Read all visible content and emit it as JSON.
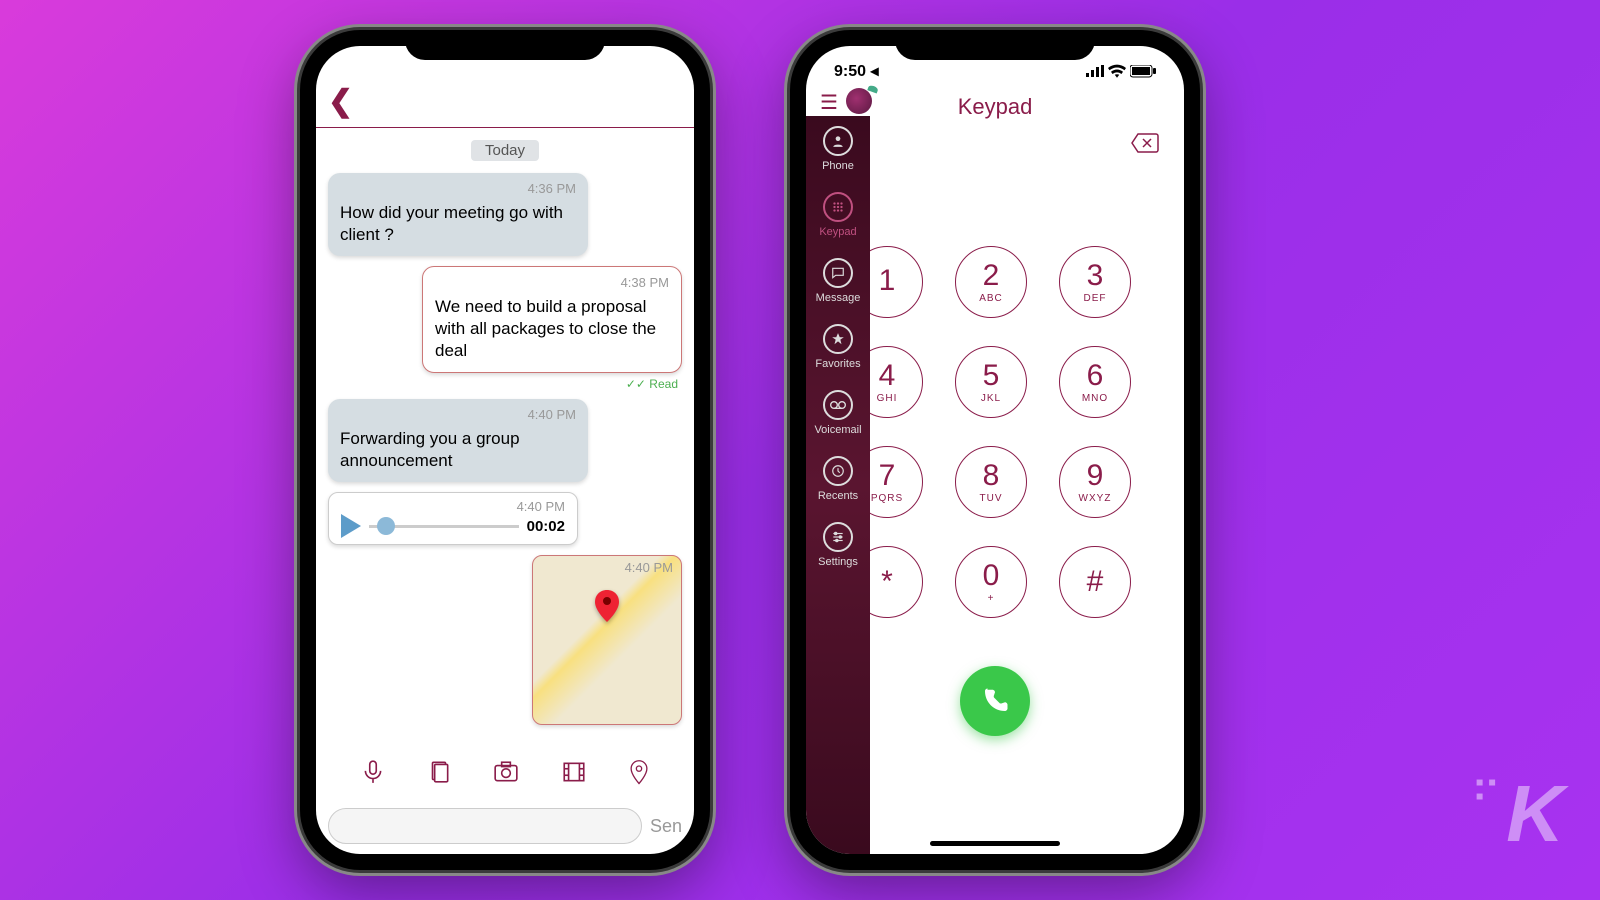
{
  "chat": {
    "day_label": "Today",
    "messages": [
      {
        "time": "4:36 PM",
        "text": "How did your meeting go with client ?"
      },
      {
        "time": "4:38 PM",
        "text": "We need to build a proposal with all packages to close the deal"
      },
      {
        "time": "4:40 PM",
        "text": "Forwarding you a group announcement"
      }
    ],
    "read_status": "✓✓ Read",
    "audio": {
      "time": "4:40 PM",
      "duration": "00:02"
    },
    "map": {
      "time": "4:40 PM"
    },
    "send_label": "Sen"
  },
  "keypad": {
    "status_time": "9:50 ◂",
    "header": "Keypad",
    "drawer": [
      {
        "label": "Phone"
      },
      {
        "label": "Keypad"
      },
      {
        "label": "Message"
      },
      {
        "label": "Favorites"
      },
      {
        "label": "Voicemail"
      },
      {
        "label": "Recents"
      },
      {
        "label": "Settings"
      }
    ],
    "keys": [
      {
        "num": "1",
        "letters": ""
      },
      {
        "num": "2",
        "letters": "ABC"
      },
      {
        "num": "3",
        "letters": "DEF"
      },
      {
        "num": "4",
        "letters": "GHI"
      },
      {
        "num": "5",
        "letters": "JKL"
      },
      {
        "num": "6",
        "letters": "MNO"
      },
      {
        "num": "7",
        "letters": "PQRS"
      },
      {
        "num": "8",
        "letters": "TUV"
      },
      {
        "num": "9",
        "letters": "WXYZ"
      },
      {
        "num": "*",
        "letters": ""
      },
      {
        "num": "0",
        "letters": "+"
      },
      {
        "num": "#",
        "letters": ""
      }
    ]
  },
  "watermark": "K"
}
